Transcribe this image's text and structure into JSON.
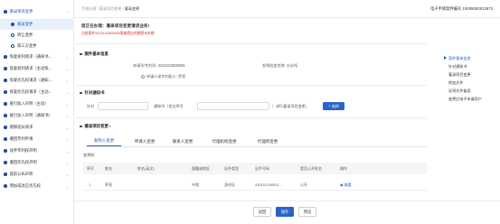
{
  "sidebar": {
    "items": [
      {
        "label": "著录项目变更",
        "arrow": "⌃",
        "type": "top"
      },
      {
        "label": "著录变更",
        "type": "sub-active"
      },
      {
        "label": "转让变更",
        "type": "sub"
      },
      {
        "label": "第三方变更",
        "type": "sub"
      },
      {
        "label": "恢复权利请求（通知书...",
        "arrow": "⌄",
        "type": "top"
      },
      {
        "label": "恢复权利请求（主动恢...",
        "arrow": "⌄",
        "type": "top"
      },
      {
        "label": "恢复优先权请求（通知...",
        "arrow": "⌄",
        "type": "top"
      },
      {
        "label": "恢复优先权请求（主动...",
        "arrow": "⌄",
        "type": "top"
      },
      {
        "label": "援引加入声明（主动）",
        "arrow": "⌄",
        "type": "top"
      },
      {
        "label": "援引加入声明（通知书）",
        "arrow": "⌄",
        "type": "top"
      },
      {
        "label": "期限延长请求",
        "arrow": "⌄",
        "type": "top"
      },
      {
        "label": "撤回专利申请",
        "arrow": "⌄",
        "type": "top"
      },
      {
        "label": "放弃专利权声明",
        "arrow": "⌄",
        "type": "top"
      },
      {
        "label": "撤回优先权声明",
        "arrow": "⌄",
        "type": "top"
      },
      {
        "label": "提前公布声明",
        "arrow": "⌄",
        "type": "top"
      },
      {
        "label": "增加或改正优先权",
        "arrow": "⌄",
        "type": "top"
      }
    ]
  },
  "header": {
    "breadcrumb_1": "手续办理",
    "breadcrumb_2": "著录项目变更",
    "breadcrumb_3": "著录变更",
    "sep": " / ",
    "right_label": "电子申请案件编号",
    "right_value": "10008082813673"
  },
  "notice": {
    "title": "您正在办理：著录项目变更请求业务!",
    "subtitle": "当前案件2022102505005案被提出的期限未补期"
  },
  "case_info": {
    "title": "案件基本信息",
    "app_no_label": "申请号/专利号:",
    "app_no_value": "2022102505005",
    "invention_label": "发明创造名称:",
    "invention_value": "水水所",
    "applicant_label": "申请人或专利权人:",
    "applicant_value": "罗亮"
  },
  "notification": {
    "title": "针对通知书",
    "pair_label": "针对",
    "notice_label": "通知书（发文序号",
    "placeholder": "请输入发文序号",
    "suffix": "）进行著录项目变更。",
    "select_button": "+ 选择"
  },
  "change": {
    "title": "著录项目变更",
    "required_mark": "*",
    "tabs": [
      "发明人变更",
      "申请人变更",
      "联系人变更",
      "代理机构变更",
      "代理师变更"
    ],
    "before_label": "变更前:",
    "columns": [
      "序号",
      "姓名",
      "姓名(英文)",
      "国籍或地区",
      "证件类型",
      "证件号码",
      "是否公开姓名",
      "操作"
    ],
    "rows": [
      {
        "no": "1",
        "name": "罗亮",
        "name_en": "",
        "nationality": "中国",
        "id_type": "身份证",
        "id_no": "430102199511...",
        "public": "公开",
        "action": "查看"
      }
    ]
  },
  "right_nav": {
    "items": [
      "案件基本信息",
      "针对通知书",
      "著录项目变更",
      "附加文件",
      "证明文件备案",
      "变更后电子申请用户"
    ]
  },
  "footer": {
    "back": "返回",
    "save": "保存",
    "preview": "预览"
  },
  "colors": {
    "primary": "#2a63c8",
    "warning": "#cc3333"
  }
}
